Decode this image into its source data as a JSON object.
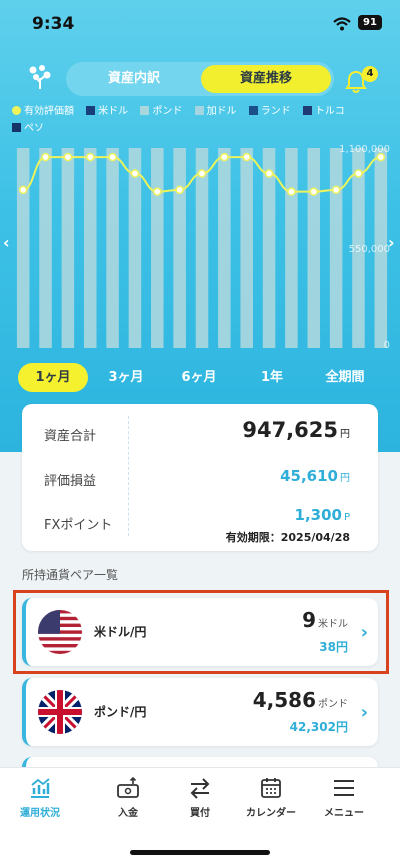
{
  "status_bar": {
    "time": "9:34",
    "battery": "91"
  },
  "header": {
    "tabs": [
      {
        "label": "資産内訳",
        "active": false
      },
      {
        "label": "資産推移",
        "active": true
      }
    ],
    "notification_count": "4"
  },
  "chart_data": {
    "type": "bar",
    "categories": [
      "",
      "",
      "",
      "",
      "",
      "",
      "",
      "",
      "",
      "",
      "",
      "",
      "",
      "",
      "",
      "",
      ""
    ],
    "series": [
      {
        "name": "有効評価額",
        "kind": "line",
        "color": "#eef35c",
        "values": [
          870000,
          1050000,
          1050000,
          1050000,
          1050000,
          960000,
          860000,
          870000,
          960000,
          1050000,
          1050000,
          960000,
          860000,
          860000,
          870000,
          960000,
          1050000
        ]
      },
      {
        "name": "米ドル",
        "color": "#1a3e7a"
      },
      {
        "name": "ポンド",
        "color": "#a9d7de",
        "values": [
          1100000,
          1100000,
          1100000,
          1100000,
          1100000,
          1100000,
          1100000,
          1100000,
          1100000,
          1100000,
          1100000,
          1100000,
          1100000,
          1100000,
          1100000,
          1100000,
          1100000
        ]
      },
      {
        "name": "加ドル",
        "color": "#a5d5e0"
      },
      {
        "name": "ランド",
        "color": "#1b4f8a"
      },
      {
        "name": "トルコ",
        "color": "#1d3b72"
      },
      {
        "name": "ペソ",
        "color": "#153366"
      }
    ],
    "y_ticks": [
      "1,100,000",
      "550,000",
      "0"
    ],
    "ylim": [
      0,
      1100000
    ],
    "grid": false,
    "legend_position": "top"
  },
  "periods": [
    {
      "label": "1ヶ月",
      "active": true
    },
    {
      "label": "3ヶ月",
      "active": false
    },
    {
      "label": "6ヶ月",
      "active": false
    },
    {
      "label": "1年",
      "active": false
    },
    {
      "label": "全期間",
      "active": false
    }
  ],
  "summary": {
    "total_label": "資産合計",
    "total_value": "947,625",
    "total_unit": "円",
    "pl_label": "評価損益",
    "pl_value": "45,610",
    "pl_unit": "円",
    "fx_label": "FXポイント",
    "fx_value": "1,300",
    "fx_unit": "P",
    "expiry": "有効期限：2025/04/28"
  },
  "section_title": "所持通貨ペア一覧",
  "pairs": [
    {
      "name": "米ドル/円",
      "qty": "9",
      "qty_unit": "米ドル",
      "value": "38",
      "value_unit": "円",
      "flag": "us-flag-icon"
    },
    {
      "name": "ポンド/円",
      "qty": "4,586",
      "qty_unit": "ポンド",
      "value": "42,302",
      "value_unit": "円",
      "flag": "uk-flag-icon"
    }
  ],
  "bottom_nav": [
    {
      "label": "運用状況",
      "icon": "portfolio-chart-icon",
      "active": true
    },
    {
      "label": "入金",
      "icon": "deposit-icon",
      "active": false
    },
    {
      "label": "買付",
      "icon": "exchange-arrows-icon",
      "active": false
    },
    {
      "label": "カレンダー",
      "icon": "calendar-icon",
      "active": false
    },
    {
      "label": "メニュー",
      "icon": "hamburger-menu-icon",
      "active": false
    }
  ]
}
